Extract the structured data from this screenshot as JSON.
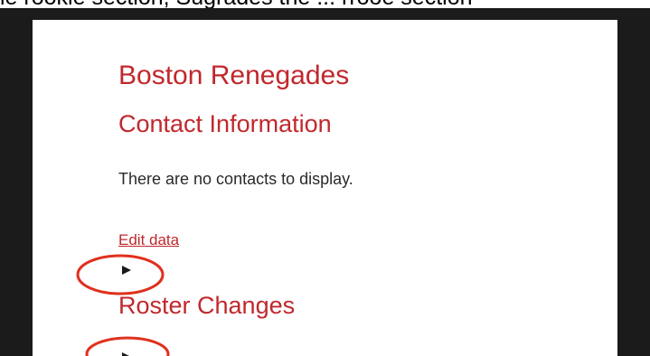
{
  "caption": {
    "text": "ie rookie section, Sugrades the ... rrooe section"
  },
  "page": {
    "team_name": "Boston Renegades",
    "contact_heading": "Contact Information",
    "no_contacts_message": "There are no contacts to display.",
    "edit_link_label": "Edit data",
    "roster_heading": "Roster Changes"
  },
  "icons": {
    "disclosure": "triangle-right-icon"
  },
  "colors": {
    "accent": "#c0282d",
    "text": "#2a2a2a",
    "frame": "#1b1b1b",
    "annotation": "#e0301e"
  }
}
